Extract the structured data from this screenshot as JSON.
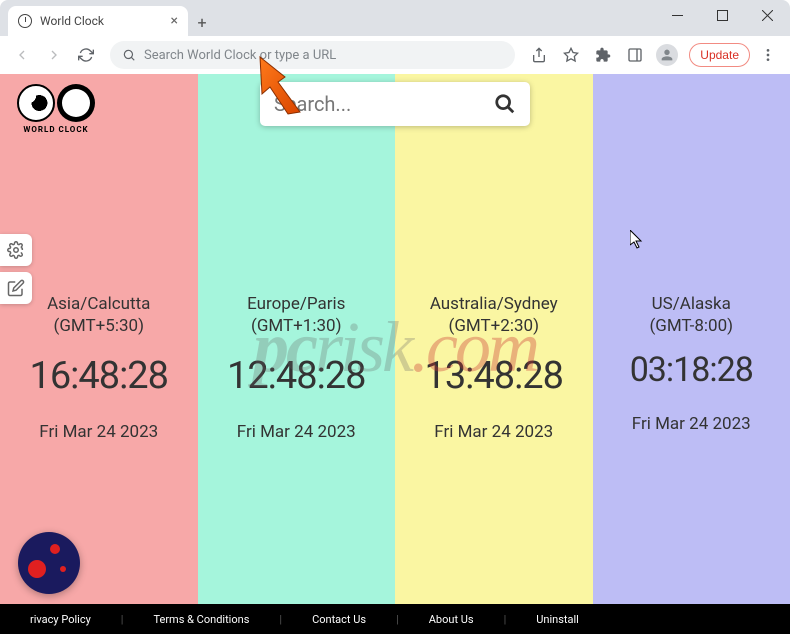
{
  "browser": {
    "tab_title": "World Clock",
    "omnibox_placeholder": "Search World Clock or type a URL",
    "update_label": "Update"
  },
  "page": {
    "logo_text": "WORLD CLOCK",
    "search_placeholder": "Search..."
  },
  "clocks": [
    {
      "zone": "Asia/Calcutta",
      "gmt": "(GMT+5:30)",
      "time": "16:48:28",
      "date": "Fri Mar 24 2023",
      "bg": "#f7a8a8"
    },
    {
      "zone": "Europe/Paris",
      "gmt": "(GMT+1:30)",
      "time": "12:48:28",
      "date": "Fri Mar 24 2023",
      "bg": "#a5f5dc"
    },
    {
      "zone": "Australia/Sydney",
      "gmt": "(GMT+2:30)",
      "time": "13:48:28",
      "date": "Fri Mar 24 2023",
      "bg": "#faf6a2"
    },
    {
      "zone": "US/Alaska",
      "gmt": "(GMT-8:00)",
      "time": "03:18:28",
      "date": "Fri Mar 24 2023",
      "bg": "#bdbdf5"
    }
  ],
  "footer": {
    "items": [
      "rivacy Policy",
      "Terms & Conditions",
      "Contact Us",
      "About Us",
      "Uninstall"
    ]
  },
  "watermark": "pcrisk.com"
}
